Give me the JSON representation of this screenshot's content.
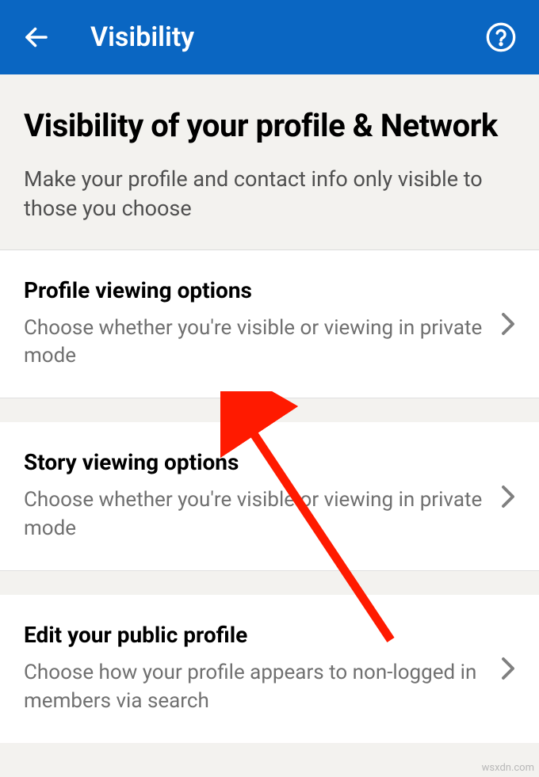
{
  "header": {
    "title": "Visibility"
  },
  "section": {
    "title": "Visibility of your profile & Network",
    "subtitle": "Make your profile and contact info only visible to those you choose"
  },
  "items": [
    {
      "title": "Profile viewing options",
      "desc": "Choose whether you're visible or viewing in private mode"
    },
    {
      "title": "Story viewing options",
      "desc": "Choose whether you're visible or viewing in private mode"
    },
    {
      "title": "Edit your public profile",
      "desc": "Choose how your profile appears to non-logged in members via search"
    }
  ],
  "watermark": "wsxdn.com"
}
